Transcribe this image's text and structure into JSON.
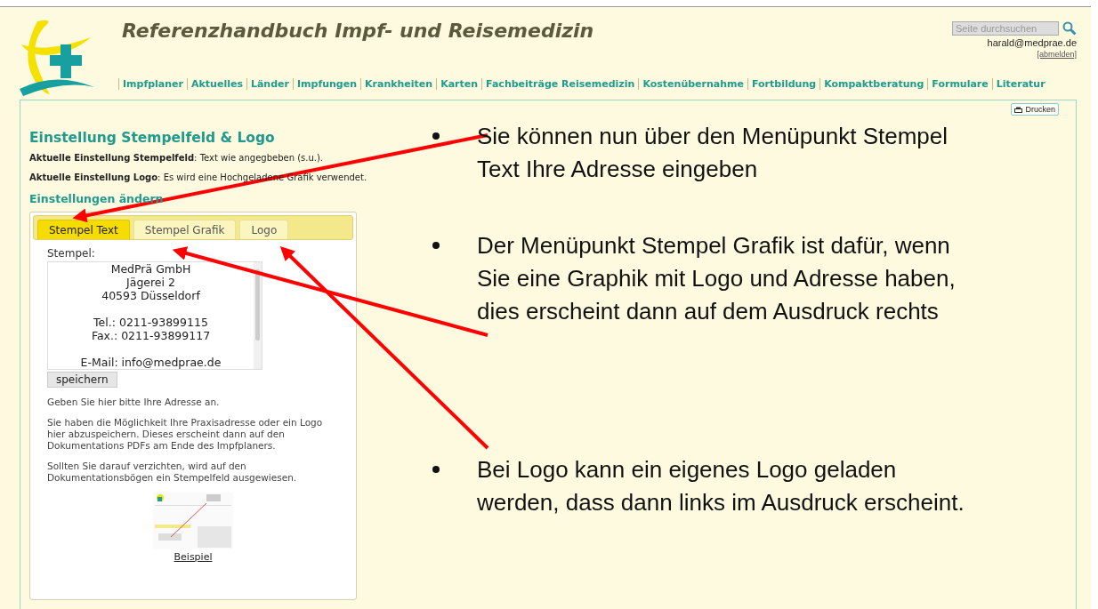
{
  "site": {
    "title": "Referenzhandbuch Impf- und Reisemedizin",
    "search": {
      "placeholder": "Seite durchsuchen"
    },
    "user": "harald@medprae.de",
    "logout": "[abmelden]",
    "nav": [
      "Impfplaner",
      "Aktuelles",
      "Länder",
      "Impfungen",
      "Krankheiten",
      "Karten",
      "Fachbeiträge Reisemedizin",
      "Kostenübernahme",
      "Fortbildung",
      "Kompaktberatung",
      "Formulare",
      "Literatur"
    ]
  },
  "print_button": "Drucken",
  "page": {
    "heading": "Einstellung Stempelfeld & Logo",
    "settings": [
      "**Aktuelle Einstellung Stempelfeld**: Text wie angegbeben (s.u.).",
      "**Aktuelle Einstellung Logo**: Es wird eine Hochgeladene Grafik verwendet."
    ],
    "subheading": "Einstellungen ändern",
    "tabs": [
      {
        "label": "Stempel Text",
        "selected": true
      },
      {
        "label": "Stempel Grafik",
        "selected": false
      },
      {
        "label": "Logo",
        "selected": false
      }
    ],
    "stamp_label": "Stempel:",
    "stamp_text": "MedPrä GmbH\nJägerei 2\n40593 Düsseldorf\n\nTel.: 0211-93899115\nFax.: 0211-93899117\n\nE-Mail: info@medprae.de",
    "save_button": "speichern",
    "paragraphs": [
      "Geben Sie hier bitte Ihre Adresse an.",
      "Sie haben die Möglichkeit Ihre Praxisadresse oder ein Logo hier abzuspeichern. Dieses erscheint dann auf den Dokumentations PDFs am Ende des Impfplaners.",
      "Sollten Sie darauf verzichten, wird auf den Dokumentationsbögen ein Stempelfeld ausgewiesen."
    ],
    "example_link": "Beispiel"
  },
  "annotations": [
    "Sie können nun über den Menüpunkt Stempel Text Ihre Adresse eingeben",
    "Der Menüpunkt Stempel Grafik ist dafür, wenn Sie eine Graphik mit Logo und Adresse haben, dies erscheint dann auf dem Ausdruck rechts",
    "Bei Logo kann ein eigenes Logo geladen werden, dass dann links im Ausdruck erscheint."
  ]
}
